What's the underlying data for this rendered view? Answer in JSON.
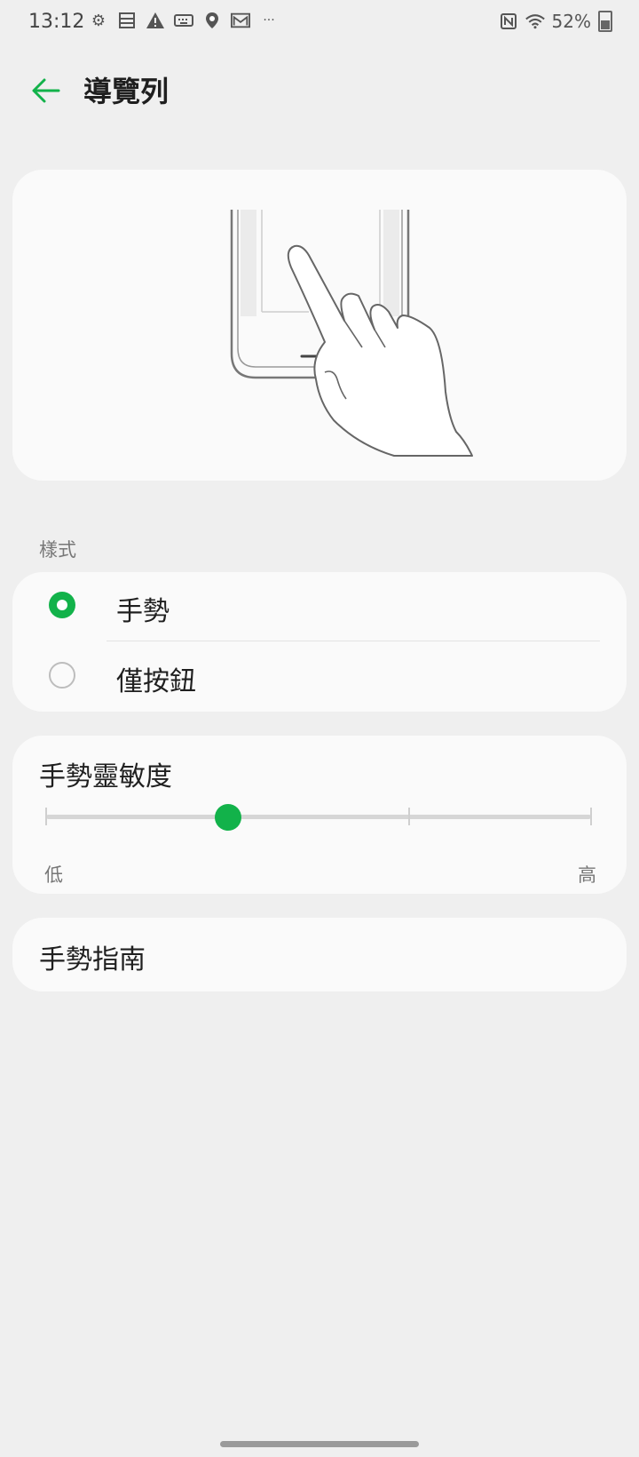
{
  "status_bar": {
    "time": "13:12",
    "left_icons": [
      "gear-icon",
      "storage-icon",
      "warning-icon",
      "keyboard-icon",
      "location-icon",
      "gmail-icon",
      "more-dots-icon"
    ],
    "battery": "52%"
  },
  "header": {
    "title": "導覽列",
    "back_icon": "arrow-left-icon"
  },
  "section": {
    "style_label": "樣式"
  },
  "style_options": [
    {
      "label": "手勢",
      "selected": true
    },
    {
      "label": "僅按鈕",
      "selected": false
    }
  ],
  "sensitivity": {
    "title": "手勢靈敏度",
    "low_label": "低",
    "high_label": "高",
    "steps": 4,
    "value_index": 1
  },
  "guide": {
    "label": "手勢指南"
  },
  "colors": {
    "accent": "#12b24a",
    "background": "#efefef",
    "card": "#fafafa"
  }
}
